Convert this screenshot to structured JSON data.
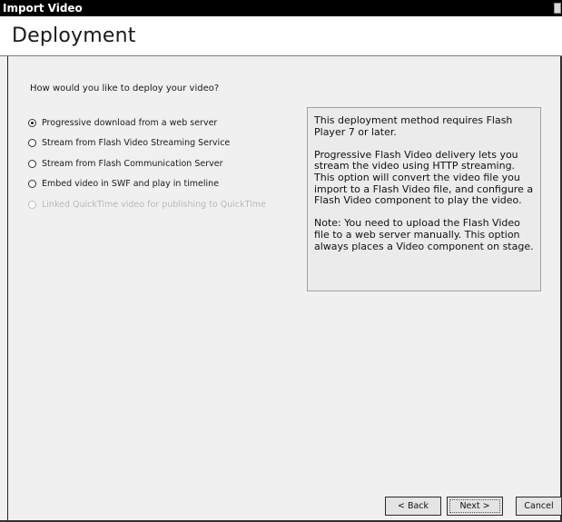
{
  "window": {
    "title": "Import Video"
  },
  "header": {
    "title": "Deployment"
  },
  "deploy": {
    "question": "How would you like to deploy your video?",
    "selected_index": 0,
    "options": [
      {
        "label": "Progressive download from a web server",
        "enabled": true,
        "checked": true
      },
      {
        "label": "Stream from Flash Video Streaming Service",
        "enabled": true,
        "checked": false
      },
      {
        "label": "Stream from Flash Communication Server",
        "enabled": true,
        "checked": false
      },
      {
        "label": "Embed video in SWF and play in timeline",
        "enabled": true,
        "checked": false
      },
      {
        "label": "Linked QuickTime video for publishing to QuickTime",
        "enabled": false,
        "checked": false
      }
    ]
  },
  "info": {
    "paragraphs": [
      "This deployment method requires Flash Player 7 or later.",
      "Progressive Flash Video delivery lets you stream the video using HTTP streaming. This option will convert the video file you import to a Flash Video file, and configure a Flash Video component to play the video.",
      "Note: You need to upload the Flash Video file to a web server manually. This option always places a Video component on stage."
    ]
  },
  "buttons": {
    "back": "< Back",
    "next": "Next >",
    "cancel": "Cancel"
  }
}
